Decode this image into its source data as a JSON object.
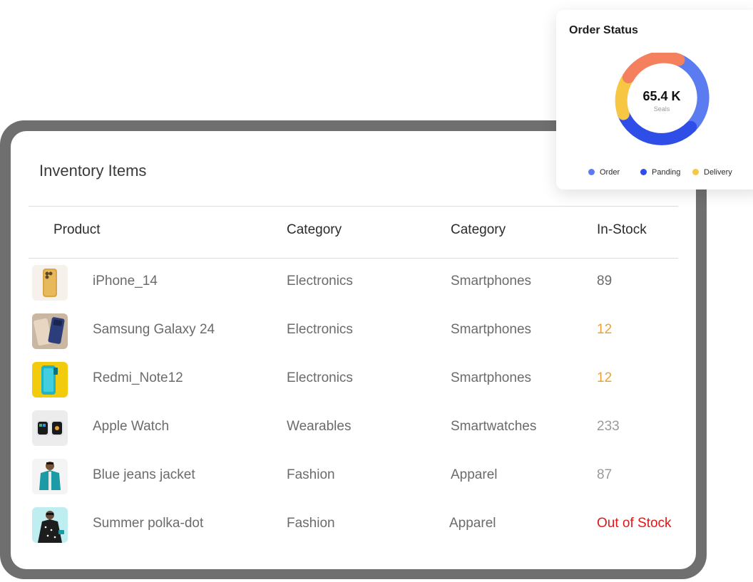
{
  "inventory": {
    "title": "Inventory Items",
    "headers": [
      "Product",
      "Category",
      "Category",
      "In-Stock"
    ],
    "rows": [
      {
        "product": "iPhone_14",
        "category": "Electronics",
        "subcategory": "Smartphones",
        "stock": "89",
        "stock_color": "#6b6b6b",
        "thumb": "phone-gold-icon"
      },
      {
        "product": "Samsung Galaxy 24",
        "category": "Electronics",
        "subcategory": "Smartphones",
        "stock": "12",
        "stock_color": "#f0a030",
        "thumb": "phones-pair-icon"
      },
      {
        "product": "Redmi_Note12",
        "category": "Electronics",
        "subcategory": "Smartphones",
        "stock": "12",
        "stock_color": "#f0a030",
        "thumb": "phone-teal-icon"
      },
      {
        "product": "Apple Watch",
        "category": "Wearables",
        "subcategory": "Smartwatches",
        "stock": "233",
        "stock_color": "#9a9a9a",
        "thumb": "smartwatch-icon"
      },
      {
        "product": "Blue jeans jacket",
        "category": "Fashion",
        "subcategory": "Apparel",
        "stock": "87",
        "stock_color": "#9a9a9a",
        "thumb": "jacket-model-icon"
      },
      {
        "product": "Summer polka-dot",
        "category": "Fashion",
        "subcategory": "Apparel",
        "stock": "Out of Stock",
        "stock_color": "#e01818",
        "thumb": "dress-model-icon"
      }
    ]
  },
  "order_status": {
    "title": "Order Status",
    "total": "65.4 K",
    "total_label": "Seals",
    "legend": [
      {
        "name": "Order",
        "color": "#5b7bf0"
      },
      {
        "name": "Panding",
        "color": "#2f4ee8"
      },
      {
        "name": "Delivery",
        "color": "#f7c643"
      }
    ],
    "segment_colors": {
      "top": "#f4805e",
      "left": "#f7c643",
      "right": "#5b7bf0",
      "bottom": "#2f4ee8"
    }
  }
}
